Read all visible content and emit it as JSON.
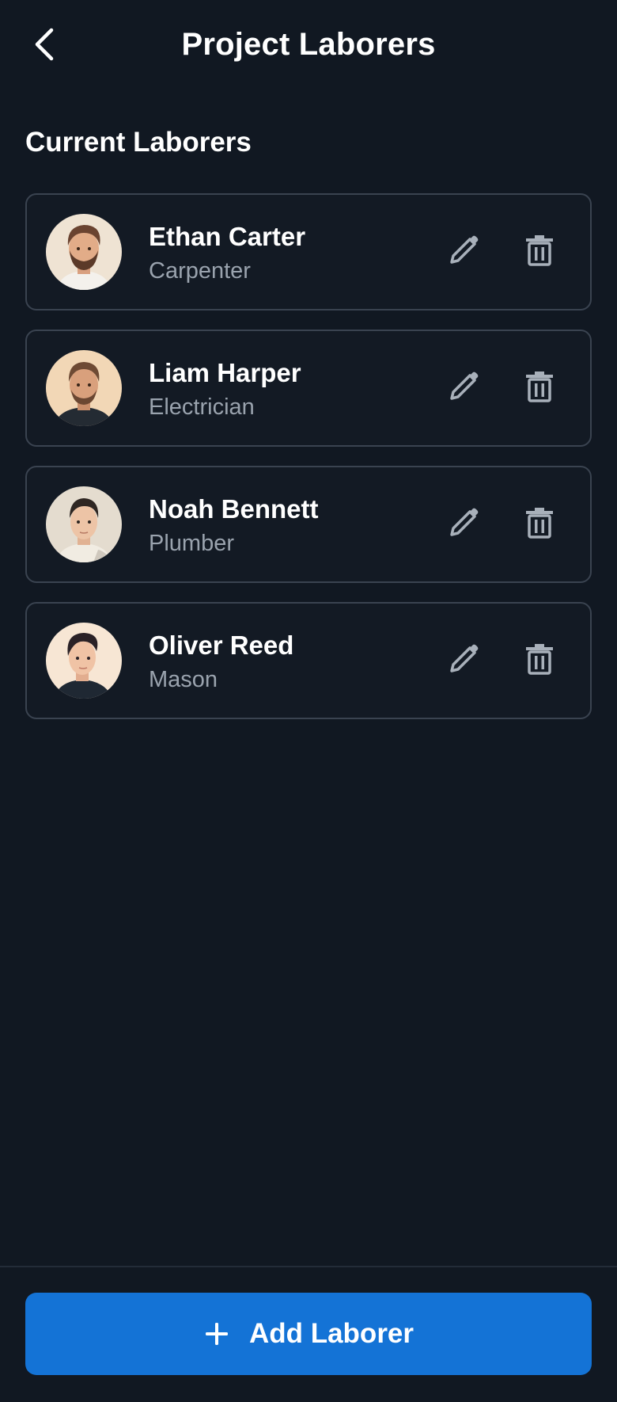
{
  "header": {
    "title": "Project Laborers",
    "back_icon": "chevron-left-icon"
  },
  "section": {
    "title": "Current Laborers"
  },
  "laborers": [
    {
      "name": "Ethan Carter",
      "role": "Carpenter"
    },
    {
      "name": "Liam Harper",
      "role": "Electrician"
    },
    {
      "name": "Noah Bennett",
      "role": "Plumber"
    },
    {
      "name": "Oliver Reed",
      "role": "Mason"
    }
  ],
  "actions": {
    "edit_icon": "pencil-icon",
    "delete_icon": "trash-icon"
  },
  "footer": {
    "add_label": "Add Laborer",
    "add_icon": "plus-icon"
  },
  "colors": {
    "background": "#111822",
    "card_border": "#3a4350",
    "muted_text": "#9aa3ae",
    "icon_gray": "#a8b0ba",
    "accent": "#1473d6"
  }
}
